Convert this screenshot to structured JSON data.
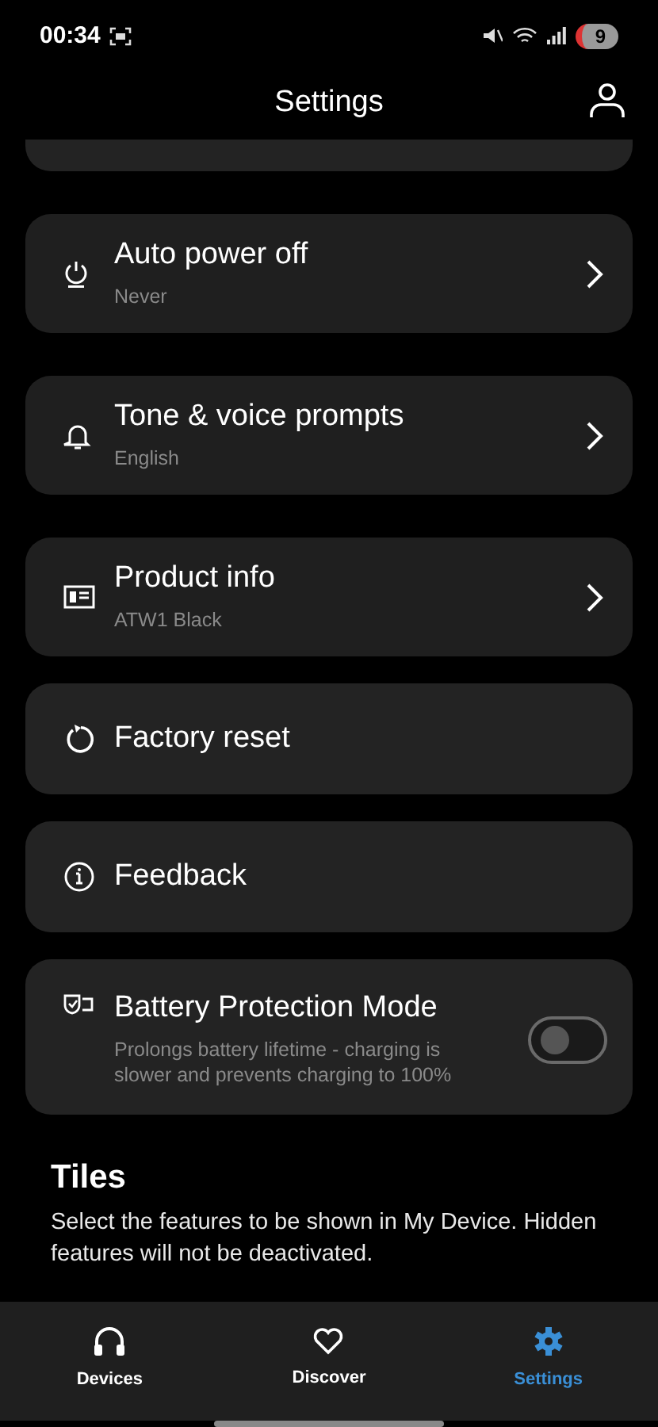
{
  "status_bar": {
    "time": "00:34",
    "battery": "9"
  },
  "header": {
    "title": "Settings"
  },
  "items": [
    {
      "kind": "nav",
      "title": "Auto power off",
      "subtitle": "Never"
    },
    {
      "kind": "nav",
      "title": "Tone & voice prompts",
      "subtitle": "English"
    },
    {
      "kind": "nav",
      "title": "Product info",
      "subtitle": "ATW1 Black"
    },
    {
      "kind": "action",
      "title": "Factory reset"
    },
    {
      "kind": "action",
      "title": "Feedback"
    },
    {
      "kind": "toggle",
      "title": "Battery Protection Mode",
      "subtitle": "Prolongs battery lifetime - charging is slower and prevents charging to 100%",
      "on": false
    }
  ],
  "tiles": {
    "title": "Tiles",
    "description": "Select the features to be shown in My Device. Hidden features will not be deactivated."
  },
  "bottom_nav": [
    {
      "label": "Devices",
      "selected": false
    },
    {
      "label": "Discover",
      "selected": false
    },
    {
      "label": "Settings",
      "selected": true
    }
  ]
}
